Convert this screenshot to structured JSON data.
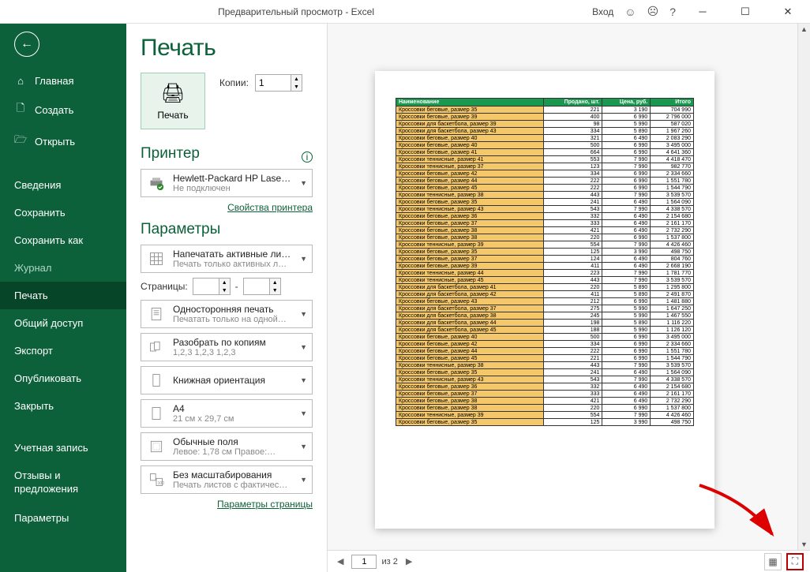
{
  "titlebar": {
    "title": "Предварительный просмотр - Excel",
    "login": "Вход"
  },
  "sidebar": {
    "home": "Главная",
    "create": "Создать",
    "open": "Открыть",
    "info": "Сведения",
    "save": "Сохранить",
    "saveas": "Сохранить как",
    "journal": "Журнал",
    "print": "Печать",
    "share": "Общий доступ",
    "export": "Экспорт",
    "publish": "Опубликовать",
    "close": "Закрыть",
    "account": "Учетная запись",
    "feedback": "Отзывы и предложения",
    "options": "Параметры"
  },
  "panel": {
    "heading": "Печать",
    "print_btn": "Печать",
    "copies_label": "Копии:",
    "copies_value": "1",
    "printer_heading": "Принтер",
    "printer_name": "Hewlett-Packard HP LaserJe…",
    "printer_status": "Не подключен",
    "printer_props": "Свойства принтера",
    "params_heading": "Параметры",
    "active_sheets": "Напечатать активные листы",
    "active_sheets_sub": "Печать только активных л…",
    "pages_label": "Страницы:",
    "pages_sep": "-",
    "one_sided": "Односторонняя печать",
    "one_sided_sub": "Печатать только на одной…",
    "collate": "Разобрать по копиям",
    "collate_sub": "1,2,3   1,2,3   1,2,3",
    "orientation": "Книжная ориентация",
    "paper": "A4",
    "paper_sub": "21 см x 29,7 см",
    "margins": "Обычные поля",
    "margins_sub": "Левое: 1,78 см   Правое:…",
    "scaling": "Без масштабирования",
    "scaling_sub": "Печать листов с фактичес…",
    "page_setup": "Параметры страницы"
  },
  "footer": {
    "page_value": "1",
    "of_text": "из 2"
  },
  "table": {
    "headers": [
      "Наименование",
      "Продано, шт.",
      "Цена, руб.",
      "Итого"
    ],
    "rows": [
      [
        "Кроссовки беговые, размер 35",
        "221",
        "3 190",
        "704 990"
      ],
      [
        "Кроссовки беговые, размер 39",
        "400",
        "6 990",
        "2 796 000"
      ],
      [
        "Кроссовки для баскетбола, размер 39",
        "98",
        "5 990",
        "587 020"
      ],
      [
        "Кроссовки для баскетбола, размер 43",
        "334",
        "5 890",
        "1 967 260"
      ],
      [
        "Кроссовки беговые, размер 40",
        "321",
        "6 490",
        "2 083 290"
      ],
      [
        "Кроссовки беговые, размер 40",
        "500",
        "6 990",
        "3 495 000"
      ],
      [
        "Кроссовки беговые, размер 41",
        "664",
        "6 990",
        "4 641 360"
      ],
      [
        "Кроссовки теннисные, размер 41",
        "553",
        "7 990",
        "4 418 470"
      ],
      [
        "Кроссовки теннисные, размер 37",
        "123",
        "7 990",
        "982 770"
      ],
      [
        "Кроссовки беговые, размер 42",
        "334",
        "6 990",
        "2 334 660"
      ],
      [
        "Кроссовки беговые, размер 44",
        "222",
        "6 990",
        "1 551 780"
      ],
      [
        "Кроссовки беговые, размер 45",
        "222",
        "6 990",
        "1 544 790"
      ],
      [
        "Кроссовки теннисные, размер 38",
        "443",
        "7 990",
        "3 539 570"
      ],
      [
        "Кроссовки беговые, размер 35",
        "241",
        "6 490",
        "1 564 090"
      ],
      [
        "Кроссовки теннисные, размер 43",
        "543",
        "7 990",
        "4 338 570"
      ],
      [
        "Кроссовки беговые, размер 36",
        "332",
        "6 490",
        "2 154 680"
      ],
      [
        "Кроссовки беговые, размер 37",
        "333",
        "6 490",
        "2 161 170"
      ],
      [
        "Кроссовки беговые, размер 38",
        "421",
        "6 490",
        "2 732 290"
      ],
      [
        "Кроссовки беговые, размер 38",
        "220",
        "6 990",
        "1 537 800"
      ],
      [
        "Кроссовки теннисные, размер 39",
        "554",
        "7 990",
        "4 426 460"
      ],
      [
        "Кроссовки беговые, размер 35",
        "125",
        "3 990",
        "498 750"
      ],
      [
        "Кроссовки беговые, размер 37",
        "124",
        "6 490",
        "804 760"
      ],
      [
        "Кроссовки беговые, размер 39",
        "411",
        "6 490",
        "2 668 190"
      ],
      [
        "Кроссовки теннисные, размер 44",
        "223",
        "7 990",
        "1 781 770"
      ],
      [
        "Кроссовки теннисные, размер 45",
        "443",
        "7 990",
        "3 539 570"
      ],
      [
        "Кроссовки для баскетбола, размер 41",
        "220",
        "5 890",
        "1 295 800"
      ],
      [
        "Кроссовки для баскетбола, размер 42",
        "411",
        "5 890",
        "2 491 870"
      ],
      [
        "Кроссовки беговые, размер 43",
        "212",
        "6 990",
        "1 481 880"
      ],
      [
        "Кроссовки для баскетбола, размер 37",
        "275",
        "5 990",
        "1 647 250"
      ],
      [
        "Кроссовки для баскетбола, размер 38",
        "245",
        "5 990",
        "1 467 550"
      ],
      [
        "Кроссовки для баскетбола, размер 44",
        "198",
        "5 890",
        "1 116 220"
      ],
      [
        "Кроссовки для баскетбола, размер 45",
        "188",
        "5 990",
        "1 126 120"
      ],
      [
        "Кроссовки беговые, размер 40",
        "500",
        "6 990",
        "3 495 000"
      ],
      [
        "Кроссовки беговые, размер 42",
        "334",
        "6 990",
        "2 334 660"
      ],
      [
        "Кроссовки беговые, размер 44",
        "222",
        "6 990",
        "1 551 780"
      ],
      [
        "Кроссовки беговые, размер 45",
        "221",
        "6 990",
        "1 544 790"
      ],
      [
        "Кроссовки теннисные, размер 38",
        "443",
        "7 990",
        "3 539 570"
      ],
      [
        "Кроссовки беговые, размер 35",
        "241",
        "6 490",
        "1 564 090"
      ],
      [
        "Кроссовки теннисные, размер 43",
        "543",
        "7 990",
        "4 338 570"
      ],
      [
        "Кроссовки беговые, размер 36",
        "332",
        "6 490",
        "2 154 680"
      ],
      [
        "Кроссовки беговые, размер 37",
        "333",
        "6 490",
        "2 161 170"
      ],
      [
        "Кроссовки беговые, размер 38",
        "421",
        "6 490",
        "2 732 290"
      ],
      [
        "Кроссовки беговые, размер 38",
        "220",
        "6 990",
        "1 537 800"
      ],
      [
        "Кроссовки теннисные, размер 39",
        "554",
        "7 990",
        "4 426 460"
      ],
      [
        "Кроссовки беговые, размер 35",
        "125",
        "3 990",
        "498 750"
      ]
    ]
  }
}
